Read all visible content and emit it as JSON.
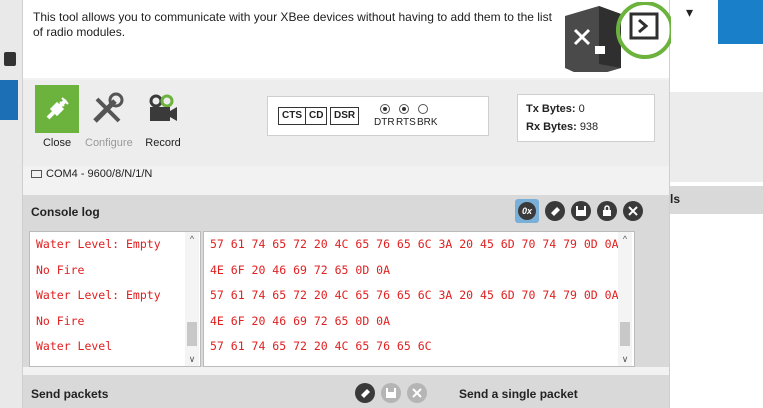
{
  "description": "This tool allows you to communicate with your XBee devices without having to add them to the list of radio modules.",
  "toolbar": {
    "close_label": "Close",
    "configure_label": "Configure",
    "record_label": "Record"
  },
  "signals": {
    "cts": "CTS",
    "cd": "CD",
    "dsr": "DSR",
    "dtr": "DTR",
    "rts": "RTS",
    "brk": "BRK"
  },
  "bytes": {
    "tx_label": "Tx Bytes:",
    "tx_value": "0",
    "rx_label": "Rx Bytes:",
    "rx_value": "938"
  },
  "port": "COM4 - 9600/8/N/1/N",
  "console": {
    "title": "Console log",
    "hex_toggle": "0x",
    "ascii_lines": [
      "Water Level: Empty",
      "No Fire",
      "Water Level: Empty",
      "No Fire",
      "Water Level"
    ],
    "hex_lines": [
      "57 61 74 65 72 20 4C 65 76 65 6C 3A 20 45 6D 70 74 79 0D 0A",
      "4E 6F 20 46 69 72 65 0D 0A",
      "57 61 74 65 72 20 4C 65 76 65 6C 3A 20 45 6D 70 74 79 0D 0A",
      "4E 6F 20 46 69 72 65 0D 0A",
      "57 61 74 65 72 20 4C 65 76 65 6C"
    ]
  },
  "send": {
    "title": "Send packets",
    "single_title": "Send a single packet"
  },
  "background": {
    "right_panel_label": "ls"
  },
  "colors": {
    "console_text": "#e02020",
    "close_green": "#6cb33e",
    "blue_accent": "#1a7fc9"
  }
}
